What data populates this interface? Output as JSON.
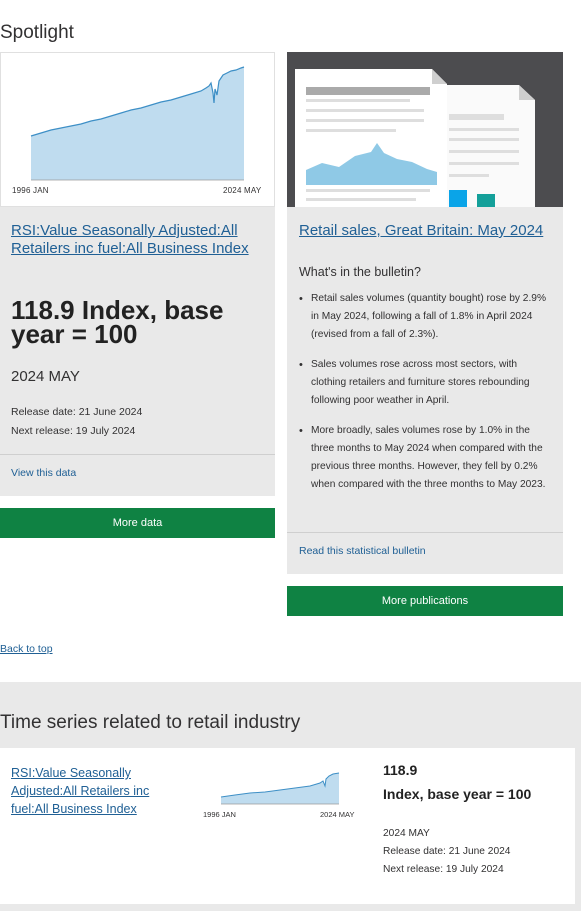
{
  "spotlight": {
    "heading": "Spotlight",
    "series_card": {
      "chart_ticks": [
        "1996 JAN",
        "2024 MAY"
      ],
      "chart_fill_color": "#bfdcef",
      "chart_line_color": "#3d8fc6",
      "link_text": "RSI:Value Seasonally Adjusted:All Retailers inc fuel:All Business Index",
      "value_text": "118.9 Index, base year = 100",
      "period": "2024 MAY",
      "release_date": "Release date: 21 June 2024",
      "next_release": "Next release: 19 July 2024",
      "view_link": "View this data",
      "button_label": "More data"
    },
    "bulletin_card": {
      "link_text": "Retail sales, Great Britain: May 2024",
      "subheading": "What's in the bulletin?",
      "bullets": [
        "Retail sales volumes (quantity bought) rose by 2.9% in May 2024, following a fall of 1.8% in April 2024 (revised from a fall of 2.3%).",
        "Sales volumes rose across most sectors, with clothing retailers and furniture stores rebounding following poor weather in April.",
        "More broadly, sales volumes rose by 1.0% in the three months to May 2024 when compared with the previous three months. However, they fell by 0.2% when compared with the three months to May 2023."
      ],
      "read_link": "Read this statistical bulletin",
      "button_label": "More publications"
    }
  },
  "back_to_top": "Back to top",
  "related": {
    "heading": "Time series related to retail industry",
    "item": {
      "link_text": "RSI:Value Seasonally Adjusted:All Retailers inc fuel:All Business Index",
      "chart_ticks": [
        "1996 JAN",
        "2024 MAY"
      ],
      "value": "118.9",
      "unit": "Index, base year = 100",
      "period": "2024 MAY",
      "release_date": "Release date: 21 June 2024",
      "next_release": "Next release: 19 July 2024"
    }
  },
  "colors": {
    "link": "#206095",
    "button": "#0f8243",
    "card_bg": "#e9e9e9"
  }
}
